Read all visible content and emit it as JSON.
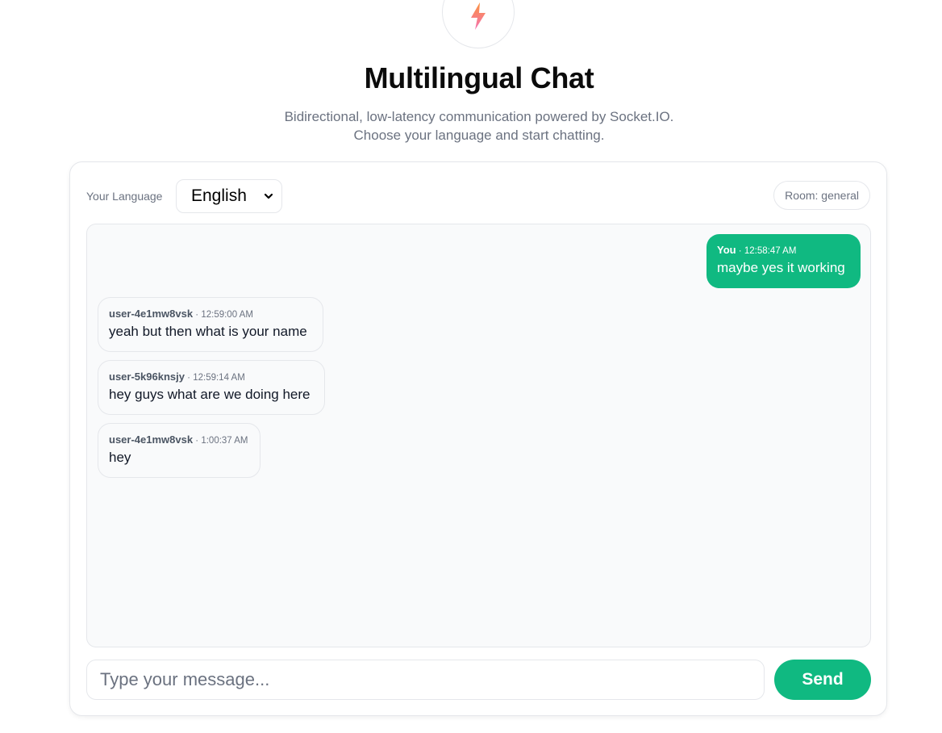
{
  "header": {
    "logo_icon": "lightning-bolt-icon",
    "title": "Multilingual Chat",
    "subtitle_line1": "Bidirectional, low-latency communication powered by Socket.IO.",
    "subtitle_line2": "Choose your language and start chatting."
  },
  "toolbar": {
    "language_label": "Your Language",
    "language_selected": "English",
    "room_badge": "Room: general"
  },
  "messages": [
    {
      "author": "You",
      "separator": "·",
      "time": "12:58:47 AM",
      "text": "maybe yes it working",
      "own": true
    },
    {
      "author": "user-4e1mw8vsk",
      "separator": "·",
      "time": "12:59:00 AM",
      "text": "yeah but then what is your name",
      "own": false
    },
    {
      "author": "user-5k96knsjy",
      "separator": "·",
      "time": "12:59:14 AM",
      "text": "hey guys what are we doing here",
      "own": false
    },
    {
      "author": "user-4e1mw8vsk",
      "separator": "·",
      "time": "1:00:37 AM",
      "text": "hey",
      "own": false
    }
  ],
  "composer": {
    "placeholder": "Type your message...",
    "value": "",
    "send_label": "Send"
  },
  "colors": {
    "accent": "#10b981",
    "logo_orange": "#f97316",
    "logo_pink": "#f472b6"
  }
}
